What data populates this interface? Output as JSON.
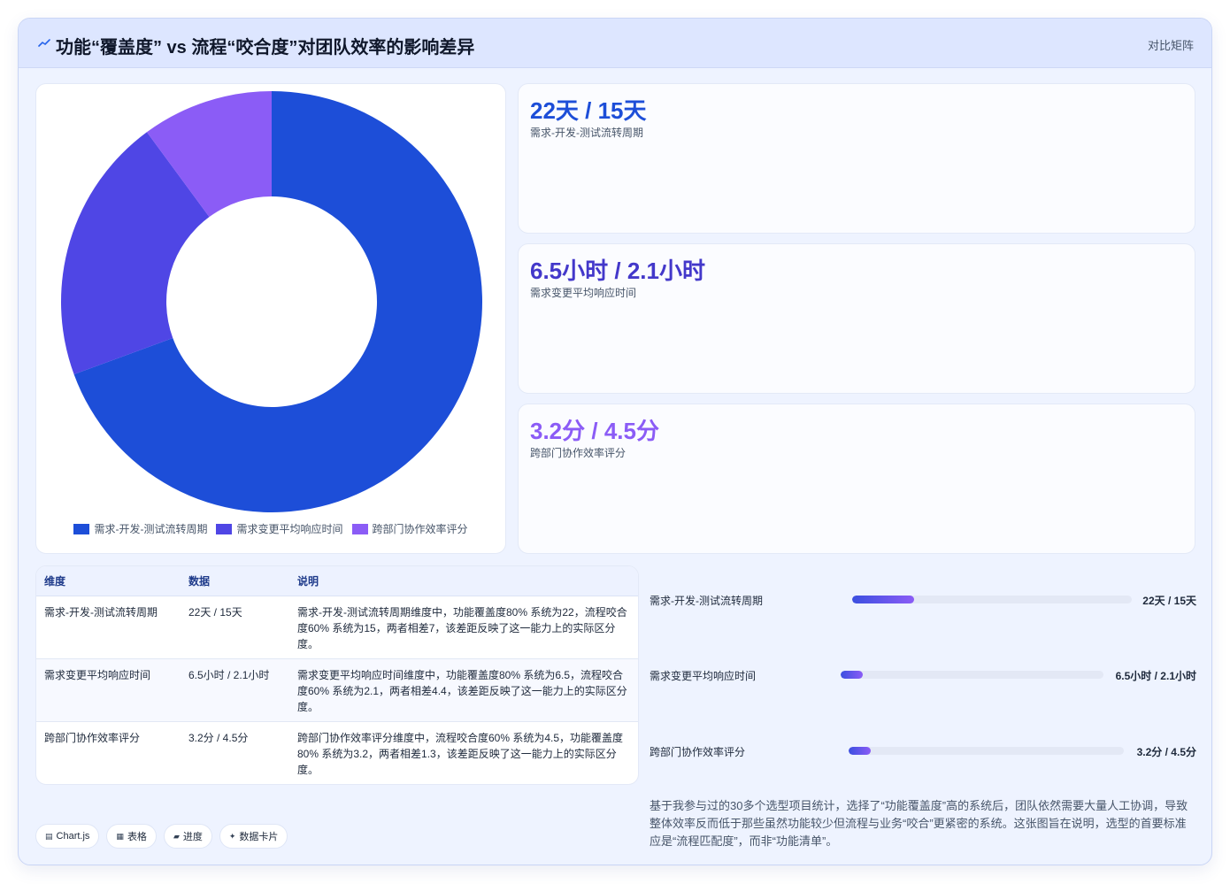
{
  "header": {
    "title": "功能“覆盖度” vs 流程“咬合度”对团队效率的影响差异",
    "tag": "对比矩阵",
    "icon": "trend-line-icon"
  },
  "colors": {
    "series1": "#1d4ed8",
    "series2": "#4f46e5",
    "series3": "#8b5cf6"
  },
  "chart_data": {
    "type": "pie",
    "categories": [
      "需求-开发-测试流转周期",
      "需求变更平均响应时间",
      "跨部门协作效率评分"
    ],
    "values": [
      22,
      6.5,
      3.2
    ],
    "colors": [
      "#1d4ed8",
      "#4f46e5",
      "#8b5cf6"
    ],
    "legend_position": "bottom"
  },
  "stats": [
    {
      "value": "22天 / 15天",
      "label": "需求-开发-测试流转周期",
      "color": "#1d4ed8"
    },
    {
      "value": "6.5小时 / 2.1小时",
      "label": "需求变更平均响应时间",
      "color": "#4338ca"
    },
    {
      "value": "3.2分 / 4.5分",
      "label": "跨部门协作效率评分",
      "color": "#8b5cf6"
    }
  ],
  "table": {
    "headers": [
      "维度",
      "数据",
      "说明"
    ],
    "rows": [
      {
        "dimension": "需求-开发-测试流转周期",
        "data": "22天 / 15天",
        "note": "需求-开发-测试流转周期维度中，功能覆盖度80% 系统为22，流程咬合度60% 系统为15，两者相差7，该差距反映了这一能力上的实际区分度。"
      },
      {
        "dimension": "需求变更平均响应时间",
        "data": "6.5小时 / 2.1小时",
        "note": "需求变更平均响应时间维度中，功能覆盖度80% 系统为6.5，流程咬合度60% 系统为2.1，两者相差4.4，该差距反映了这一能力上的实际区分度。"
      },
      {
        "dimension": "跨部门协作效率评分",
        "data": "3.2分 / 4.5分",
        "note": "跨部门协作效率评分维度中，流程咬合度60% 系统为4.5，功能覆盖度80% 系统为3.2，两者相差1.3，该差距反映了这一能力上的实际区分度。"
      }
    ]
  },
  "progress": [
    {
      "label": "需求-开发-测试流转周期",
      "value": "22天 / 15天",
      "fraction": 0.22
    },
    {
      "label": "需求变更平均响应时间",
      "value": "6.5小时 / 2.1小时",
      "fraction": 0.085
    },
    {
      "label": "跨部门协作效率评分",
      "value": "3.2分 / 4.5分",
      "fraction": 0.08
    }
  ],
  "summary": "基于我参与过的30多个选型项目统计，选择了“功能覆盖度”高的系统后，团队依然需要大量人工协调，导致整体效率反而低于那些虽然功能较少但流程与业务“咬合”更紧密的系统。这张图旨在说明，选型的首要标准应是“流程匹配度”，而非“功能清单”。",
  "chips": [
    {
      "icon": "chart-icon",
      "label": "Chart.js"
    },
    {
      "icon": "table-icon",
      "label": "表格"
    },
    {
      "icon": "progress-icon",
      "label": "进度"
    },
    {
      "icon": "sparkle-icon",
      "label": "数据卡片"
    }
  ]
}
